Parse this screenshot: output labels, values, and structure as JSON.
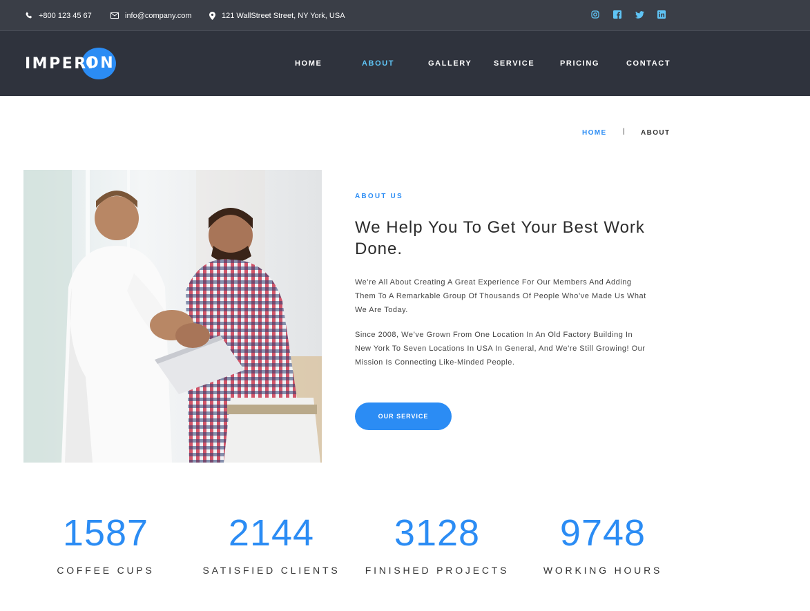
{
  "topbar": {
    "phone": "+800 123 45 67",
    "email": "info@company.com",
    "address": "121 WallStreet Street, NY York, USA",
    "socials": [
      "instagram-icon",
      "facebook-icon",
      "twitter-icon",
      "linkedin-icon"
    ]
  },
  "brand": {
    "logo_main": "IMPERI",
    "logo_accent": "ON",
    "accent_color": "#2b8cf4"
  },
  "nav": {
    "items": [
      {
        "label": "HOME"
      },
      {
        "label": "ABOUT"
      },
      {
        "label": "GALLERY"
      },
      {
        "label": "SERVICE"
      },
      {
        "label": "PRICING"
      },
      {
        "label": "CONTACT"
      }
    ],
    "active": "ABOUT"
  },
  "breadcrumb": {
    "home": "HOME",
    "separator": "|",
    "current": "ABOUT"
  },
  "about": {
    "label": "ABOUT US",
    "title": "We Help You To Get Your Best Work Done.",
    "p1": "We’re All About Creating A Great Experience For Our Members And Adding Them To A Remarkable Group Of Thousands Of People Who’ve Made Us What We Are Today.",
    "p2": "Since 2008, We’ve Grown From One Location In An Old Factory Building In New York To Seven Locations In USA In General, And We’re Still Growing! Our Mission Is Connecting Like-Minded People.",
    "button": "OUR SERVICE"
  },
  "stats": [
    {
      "value": "1587",
      "label": "COFFEE CUPS"
    },
    {
      "value": "2144",
      "label": "SATISFIED CLIENTS"
    },
    {
      "value": "3128",
      "label": "FINISHED PROJECTS"
    },
    {
      "value": "9748",
      "label": "WORKING HOURS"
    }
  ]
}
